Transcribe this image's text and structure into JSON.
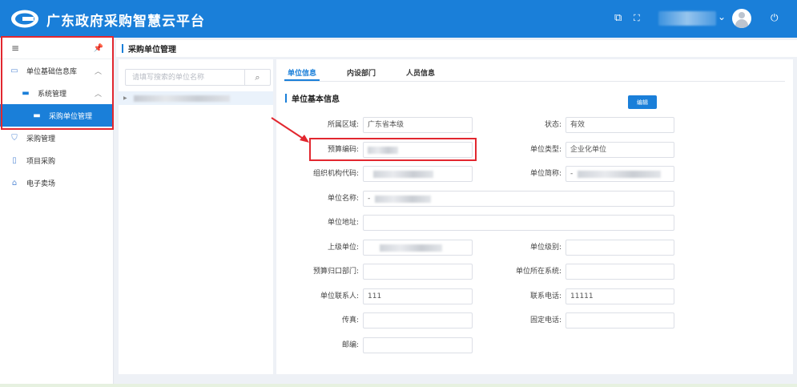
{
  "app": {
    "title": "广东政府采购智慧云平台"
  },
  "header": {
    "icons": [
      "resize-icon",
      "fullscreen-icon",
      "chevron-down-icon",
      "avatar",
      "power-icon"
    ]
  },
  "sidebar": {
    "icons": [
      "menu-icon",
      "pin-icon"
    ],
    "items": [
      {
        "label": "单位基础信息库",
        "icon": "database-icon",
        "level": 1,
        "expanded": true
      },
      {
        "label": "系统管理",
        "icon": "monitor-icon",
        "level": 2,
        "expanded": true
      },
      {
        "label": "采购单位管理",
        "icon": "monitor-icon",
        "level": 3,
        "active": true
      },
      {
        "label": "采购管理",
        "icon": "shield-icon",
        "level": 1
      },
      {
        "label": "项目采购",
        "icon": "document-icon",
        "level": 1
      },
      {
        "label": "电子卖场",
        "icon": "store-icon",
        "level": 1
      }
    ]
  },
  "page": {
    "title": "采购单位管理"
  },
  "tree": {
    "search_placeholder": "请填写搜索的单位名称"
  },
  "detail": {
    "tabs": [
      {
        "label": "单位信息",
        "active": true
      },
      {
        "label": "内设部门"
      },
      {
        "label": "人员信息"
      }
    ],
    "section_title": "单位基本信息",
    "edit_label": "编辑",
    "fields": {
      "region": {
        "label": "所属区域:",
        "value": "广东省本级"
      },
      "status": {
        "label": "状态:",
        "value": "有效"
      },
      "budget_code": {
        "label": "预算编码:",
        "value": ""
      },
      "unit_type": {
        "label": "单位类型:",
        "value": "企业化单位"
      },
      "org_code": {
        "label": "组织机构代码:",
        "value": ""
      },
      "short_name": {
        "label": "单位简称:",
        "value": "-"
      },
      "unit_name": {
        "label": "单位名称:",
        "value": "-"
      },
      "address": {
        "label": "单位地址:",
        "value": ""
      },
      "parent_unit": {
        "label": "上级单位:",
        "value": ""
      },
      "unit_level": {
        "label": "单位级别:",
        "value": ""
      },
      "budget_dept": {
        "label": "预算归口部门:",
        "value": ""
      },
      "system": {
        "label": "单位所在系统:",
        "value": ""
      },
      "contact": {
        "label": "单位联系人:",
        "value": "111"
      },
      "phone": {
        "label": "联系电话:",
        "value": "11111"
      },
      "fax": {
        "label": "传真:",
        "value": ""
      },
      "landline": {
        "label": "固定电话:",
        "value": ""
      },
      "postcode": {
        "label": "邮编:",
        "value": ""
      }
    }
  },
  "colors": {
    "primary": "#1a7fd9",
    "annotation": "#e2272f"
  }
}
